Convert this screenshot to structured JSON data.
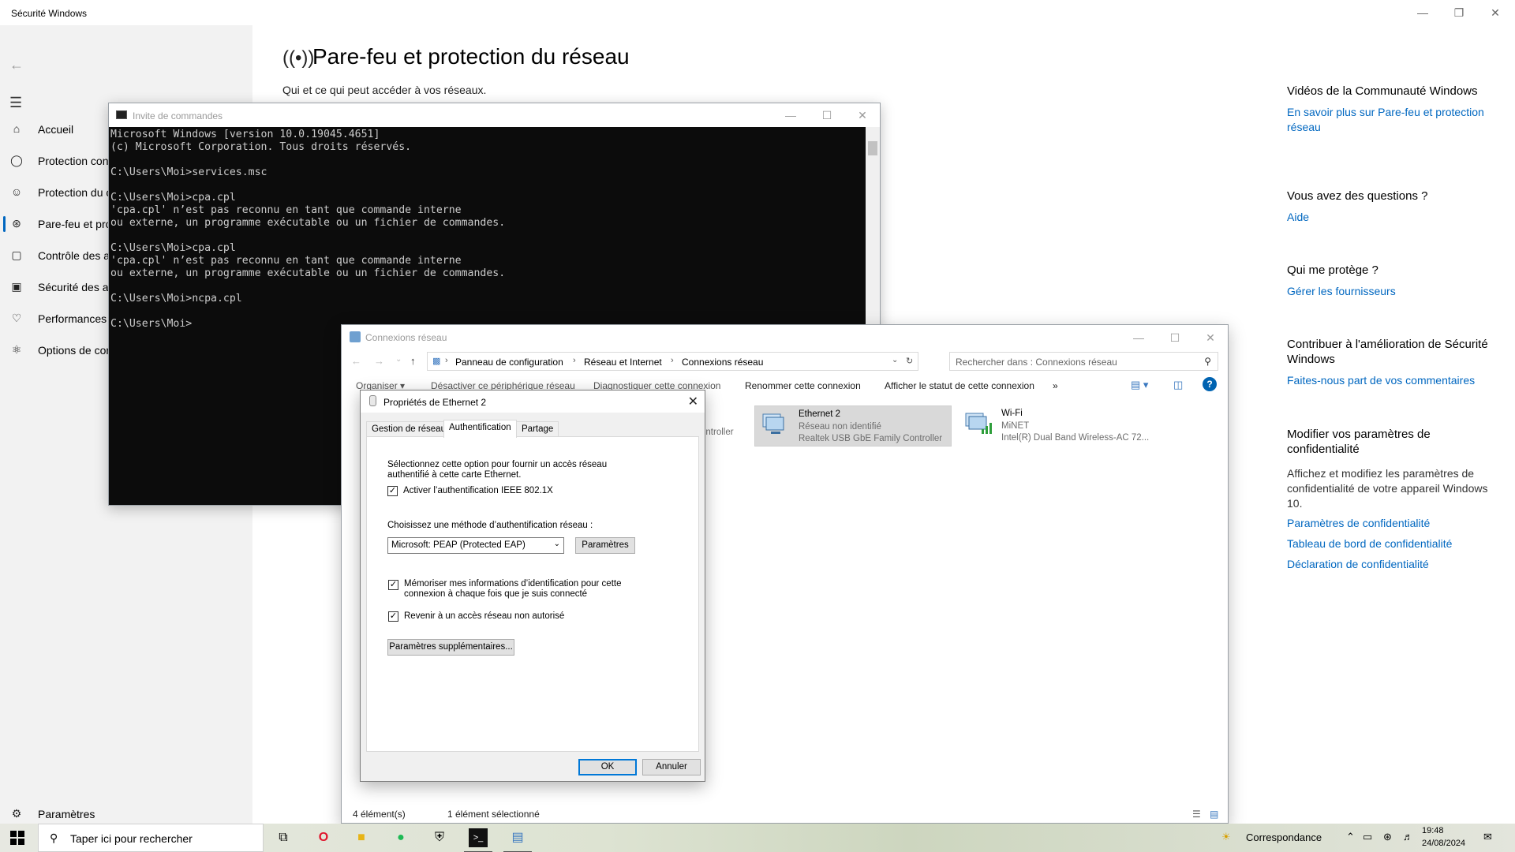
{
  "security": {
    "window_title": "Sécurité Windows",
    "page_title": "Pare-feu et protection du réseau",
    "page_subtitle": "Qui et ce qui peut accéder à vos réseaux.",
    "nav": [
      {
        "label": "Accueil",
        "icon": "home-icon"
      },
      {
        "label": "Protection con",
        "icon": "shield-icon"
      },
      {
        "label": "Protection du c",
        "icon": "person-icon"
      },
      {
        "label": "Pare-feu et pro",
        "icon": "wireless-icon"
      },
      {
        "label": "Contrôle des a",
        "icon": "app-browser-icon"
      },
      {
        "label": "Sécurité des ap",
        "icon": "laptop-icon"
      },
      {
        "label": "Performances e",
        "icon": "heart-icon"
      },
      {
        "label": "Options de cor",
        "icon": "family-icon"
      }
    ],
    "settings_label": "Paramètres",
    "right_panel": {
      "videos_title": "Vidéos de la Communauté Windows",
      "videos_link": "En savoir plus sur Pare-feu et protection réseau",
      "questions_title": "Vous avez des questions ?",
      "questions_link": "Aide",
      "protect_title": "Qui me protège ?",
      "protect_link": "Gérer les fournisseurs",
      "contribute_title": "Contribuer à l'amélioration de Sécurité Windows",
      "contribute_link": "Faites-nous part de vos commentaires",
      "privacy_title": "Modifier vos paramètres de confidentialité",
      "privacy_text": "Affichez et modifiez les paramètres de confidentialité de votre appareil Windows 10.",
      "privacy_links": [
        "Paramètres de confidentialité",
        "Tableau de bord de confidentialité",
        "Déclaration de confidentialité"
      ]
    }
  },
  "cmd": {
    "title": "Invite de commandes",
    "output": "Microsoft Windows [version 10.0.19045.4651]\n(c) Microsoft Corporation. Tous droits réservés.\n\nC:\\Users\\Moi>services.msc\n\nC:\\Users\\Moi>cpa.cpl\n'cpa.cpl' n’est pas reconnu en tant que commande interne\nou externe, un programme exécutable ou un fichier de commandes.\n\nC:\\Users\\Moi>cpa.cpl\n'cpa.cpl' n’est pas reconnu en tant que commande interne\nou externe, un programme exécutable ou un fichier de commandes.\n\nC:\\Users\\Moi>ncpa.cpl\n\nC:\\Users\\Moi>"
  },
  "ncp": {
    "title": "Connexions réseau",
    "breadcrumb": [
      "Panneau de configuration",
      "Réseau et Internet",
      "Connexions réseau"
    ],
    "search_placeholder": "Rechercher dans : Connexions réseau",
    "toolbar": [
      "Organiser ▾",
      "Désactiver ce périphérique réseau",
      "Diagnostiquer cette connexion",
      "Renommer cette connexion",
      "Afficher le statut de cette connexion",
      "»"
    ],
    "partial_item_text": "ontroller",
    "items": [
      {
        "name": "Ethernet 2",
        "status": "Réseau non identifié",
        "device": "Realtek USB GbE Family Controller"
      },
      {
        "name": "Wi-Fi",
        "status": "MiNET",
        "device": "Intel(R) Dual Band Wireless-AC 72..."
      }
    ],
    "status_count": "4 élément(s)",
    "status_selected": "1 élément sélectionné"
  },
  "dialog": {
    "title": "Propriétés de Ethernet 2",
    "tabs": [
      "Gestion de réseau",
      "Authentification",
      "Partage"
    ],
    "intro_line1": "Sélectionnez cette option pour fournir un accès réseau",
    "intro_line2": "authentifié à cette carte Ethernet.",
    "enable_8021x": "Activer l’authentification IEEE 802.1X",
    "method_label": "Choisissez une méthode d’authentification réseau :",
    "method_value": "Microsoft: PEAP (Protected EAP)",
    "params_button": "Paramètres",
    "remember_line1": "Mémoriser mes informations d’identification pour cette",
    "remember_line2": "connexion à chaque fois que je suis connecté",
    "fallback": "Revenir à un accès réseau non autorisé",
    "extra_button": "Paramètres supplémentaires...",
    "ok_button": "OK",
    "cancel_button": "Annuler"
  },
  "taskbar": {
    "search_placeholder": "Taper ici pour rechercher",
    "weather_text": "Correspondance",
    "time": "19:48",
    "date": "24/08/2024"
  }
}
